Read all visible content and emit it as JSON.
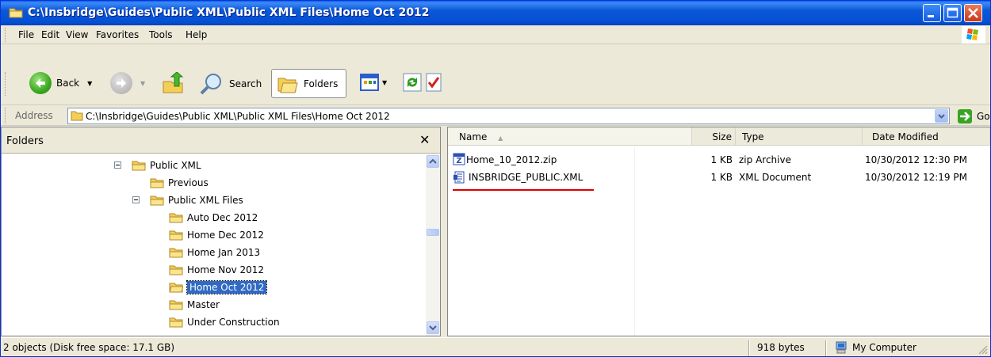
{
  "window": {
    "title": "C:\\Insbridge\\Guides\\Public XML\\Public XML Files\\Home Oct 2012",
    "accent": "#0a57d8"
  },
  "menu": [
    "File",
    "Edit",
    "View",
    "Favorites",
    "Tools",
    "Help"
  ],
  "toolbar": {
    "back": "Back",
    "search": "Search",
    "folders": "Folders"
  },
  "address": {
    "label": "Address",
    "value": "C:\\Insbridge\\Guides\\Public XML\\Public XML Files\\Home Oct 2012",
    "go": "Go"
  },
  "folders_pane": {
    "title": "Folders",
    "tree": [
      {
        "label": "Public XML",
        "expanded": true
      },
      {
        "label": "Previous"
      },
      {
        "label": "Public XML Files",
        "expanded": true
      },
      {
        "label": "Auto Dec 2012"
      },
      {
        "label": "Home Dec 2012"
      },
      {
        "label": "Home Jan 2013"
      },
      {
        "label": "Home Nov 2012"
      },
      {
        "label": "Home Oct 2012",
        "selected": true
      },
      {
        "label": "Master"
      },
      {
        "label": "Under Construction"
      }
    ]
  },
  "files_pane": {
    "columns": [
      "Name",
      "Size",
      "Type",
      "Date Modified"
    ],
    "rows": [
      {
        "name": "Home_10_2012.zip",
        "size": "1 KB",
        "type": "zip Archive",
        "date": "10/30/2012 12:30 PM",
        "icon": "zip-icon"
      },
      {
        "name": "INSBRIDGE_PUBLIC.XML",
        "size": "1 KB",
        "type": "XML Document",
        "date": "10/30/2012 12:19 PM",
        "icon": "xml-document-icon",
        "underline_color": "#e00000"
      }
    ]
  },
  "status": {
    "objects": "2 objects (Disk free space: 17.1 GB)",
    "bytes": "918 bytes",
    "zone": "My Computer"
  }
}
